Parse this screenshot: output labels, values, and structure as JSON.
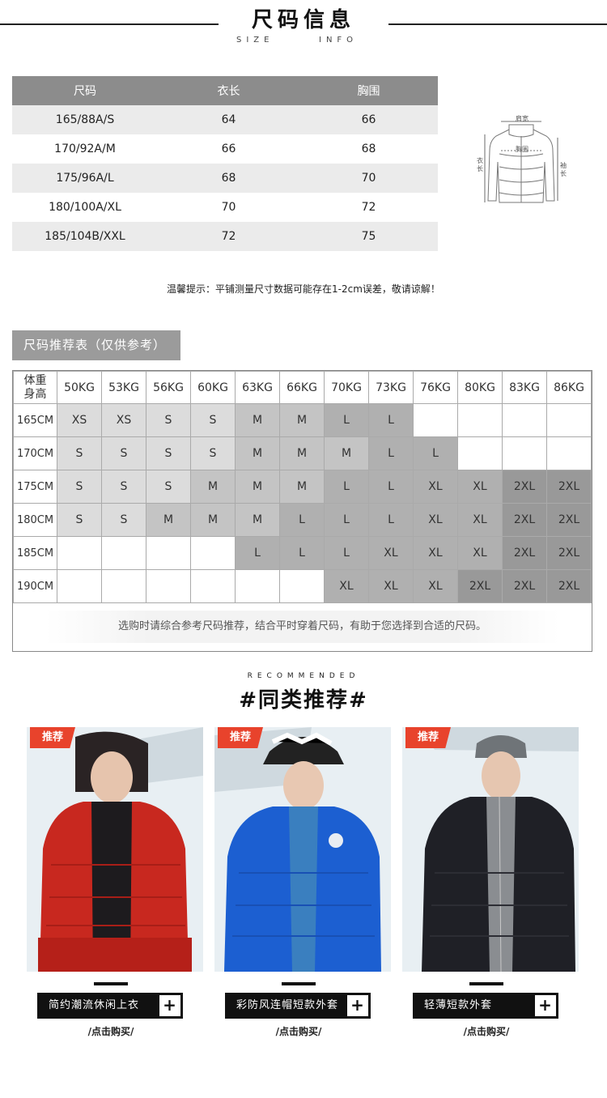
{
  "header": {
    "title": "尺码信息",
    "subtitle_left": "SIZE",
    "subtitle_right": "INFO"
  },
  "size_table": {
    "headers": [
      "尺码",
      "衣长",
      "胸围"
    ],
    "rows": [
      [
        "165/88A/S",
        "64",
        "66"
      ],
      [
        "170/92A/M",
        "66",
        "68"
      ],
      [
        "175/96A/L",
        "68",
        "70"
      ],
      [
        "180/100A/XL",
        "70",
        "72"
      ],
      [
        "185/104B/XXL",
        "72",
        "75"
      ]
    ]
  },
  "diagram": {
    "shoulder": "肩宽",
    "chest": "胸围",
    "length_a": "衣",
    "length_b": "长",
    "sleeve_a": "袖",
    "sleeve_b": "长"
  },
  "tip": "温馨提示：平铺测量尺寸数据可能存在1-2cm误差，敬请谅解！",
  "recommend_tag": "尺码推荐表（仅供参考）",
  "recommend_grid": {
    "corner_top": "体重",
    "corner_bottom": "身高",
    "weights": [
      "50KG",
      "53KG",
      "56KG",
      "60KG",
      "63KG",
      "66KG",
      "70KG",
      "73KG",
      "76KG",
      "80KG",
      "83KG",
      "86KG"
    ],
    "rows": [
      {
        "height": "165CM",
        "sizes": [
          "XS",
          "XS",
          "S",
          "S",
          "M",
          "M",
          "L",
          "L",
          "",
          "",
          "",
          ""
        ]
      },
      {
        "height": "170CM",
        "sizes": [
          "S",
          "S",
          "S",
          "S",
          "M",
          "M",
          "M",
          "L",
          "L",
          "",
          "",
          ""
        ]
      },
      {
        "height": "175CM",
        "sizes": [
          "S",
          "S",
          "S",
          "M",
          "M",
          "M",
          "L",
          "L",
          "XL",
          "XL",
          "2XL",
          "2XL"
        ]
      },
      {
        "height": "180CM",
        "sizes": [
          "S",
          "S",
          "M",
          "M",
          "M",
          "L",
          "L",
          "L",
          "XL",
          "XL",
          "2XL",
          "2XL"
        ]
      },
      {
        "height": "185CM",
        "sizes": [
          "",
          "",
          "",
          "",
          "L",
          "L",
          "L",
          "XL",
          "XL",
          "XL",
          "2XL",
          "2XL"
        ]
      },
      {
        "height": "190CM",
        "sizes": [
          "",
          "",
          "",
          "",
          "",
          "",
          "XL",
          "XL",
          "XL",
          "2XL",
          "2XL",
          "2XL"
        ]
      }
    ],
    "note": "选购时请综合参考尺码推荐，结合平时穿着尺码，有助于您选择到合适的尺码。"
  },
  "recommended": {
    "en": "RECOMMENDED",
    "cn": "#同类推荐#",
    "badge": "推荐",
    "buy": "/点击购买/",
    "plus": "+",
    "products": [
      {
        "name": "简约潮流休闲上衣",
        "color": "#c8281f"
      },
      {
        "name": "彩防风连帽短款外套",
        "color": "#1c5fd1"
      },
      {
        "name": "轻薄短款外套",
        "color": "#1f2026"
      }
    ]
  }
}
